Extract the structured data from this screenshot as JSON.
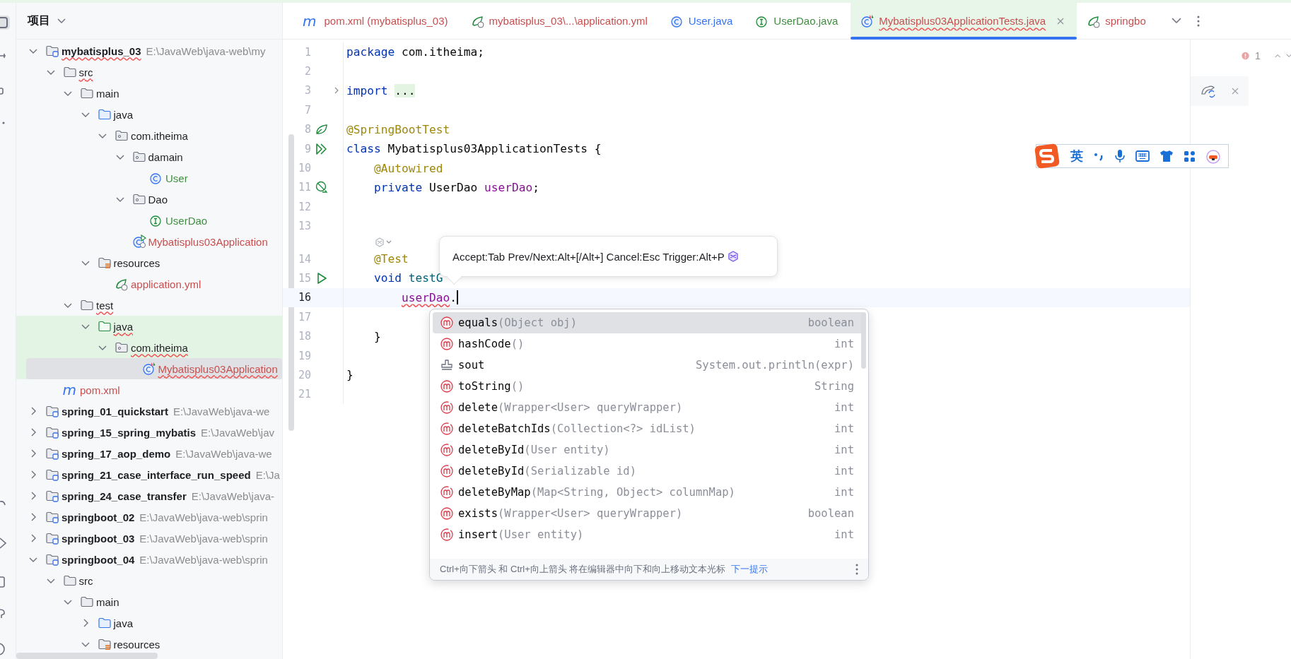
{
  "project_panel": {
    "title": "项目"
  },
  "tree": [
    {
      "label": "mybatisplus_03",
      "path": "E:\\JavaWeb\\java-web\\my",
      "kind": "module",
      "expanded": true,
      "selected": false,
      "highlighted": false,
      "error": true,
      "children": [
        {
          "label": "src",
          "kind": "folder",
          "expanded": true,
          "selected": false,
          "highlighted": false,
          "error": true,
          "children": [
            {
              "label": "main",
              "kind": "folder",
              "expanded": true,
              "selected": false,
              "highlighted": false,
              "error": false,
              "children": [
                {
                  "label": "java",
                  "kind": "source-folder",
                  "expanded": true,
                  "selected": false,
                  "highlighted": false,
                  "error": false,
                  "children": [
                    {
                      "label": "com.itheima",
                      "kind": "package",
                      "expanded": true,
                      "selected": false,
                      "highlighted": false,
                      "error": false,
                      "children": [
                        {
                          "label": "damain",
                          "kind": "package",
                          "expanded": true,
                          "selected": false,
                          "highlighted": false,
                          "error": false,
                          "children": [
                            {
                              "label": "User",
                              "kind": "class",
                              "color": "#3f8f3f",
                              "selected": false,
                              "highlighted": false,
                              "error": false
                            }
                          ]
                        },
                        {
                          "label": "Dao",
                          "kind": "package",
                          "expanded": true,
                          "selected": false,
                          "highlighted": false,
                          "error": false,
                          "children": [
                            {
                              "label": "UserDao",
                              "kind": "interface",
                              "color": "#3f8f3f",
                              "selected": false,
                              "highlighted": false,
                              "error": false
                            }
                          ]
                        },
                        {
                          "label": "Mybatisplus03Application",
                          "kind": "spring-class",
                          "color": "#c94f4f",
                          "selected": false,
                          "highlighted": false,
                          "error": false
                        }
                      ]
                    }
                  ]
                },
                {
                  "label": "resources",
                  "kind": "resources",
                  "expanded": true,
                  "selected": false,
                  "highlighted": false,
                  "error": false,
                  "children": [
                    {
                      "label": "application.yml",
                      "kind": "spring-file",
                      "color": "#c94f4f",
                      "selected": false,
                      "highlighted": false,
                      "error": false
                    }
                  ]
                }
              ]
            },
            {
              "label": "test",
              "kind": "folder",
              "expanded": true,
              "selected": false,
              "highlighted": false,
              "error": true,
              "children": [
                {
                  "label": "java",
                  "kind": "test-folder",
                  "expanded": true,
                  "selected": false,
                  "highlighted": true,
                  "error": true,
                  "children": [
                    {
                      "label": "com.itheima",
                      "kind": "package",
                      "expanded": true,
                      "selected": false,
                      "highlighted": true,
                      "error": true,
                      "children": [
                        {
                          "label": "Mybatisplus03Application",
                          "kind": "test-class",
                          "color": "#c94f4f",
                          "selected": true,
                          "highlighted": true,
                          "error": true
                        }
                      ]
                    }
                  ]
                }
              ]
            }
          ]
        },
        {
          "label": "pom.xml",
          "kind": "pom",
          "glyph": "m",
          "color": "#c94f4f",
          "selected": false,
          "highlighted": false,
          "error": false
        }
      ]
    },
    {
      "label": "spring_01_quickstart",
      "path": "E:\\JavaWeb\\java-we",
      "kind": "module",
      "expanded": false,
      "selected": false,
      "highlighted": false,
      "error": false
    },
    {
      "label": "spring_15_spring_mybatis",
      "path": "E:\\JavaWeb\\jav",
      "kind": "module",
      "expanded": false,
      "selected": false,
      "highlighted": false,
      "error": false
    },
    {
      "label": "spring_17_aop_demo",
      "path": "E:\\JavaWeb\\java-we",
      "kind": "module",
      "expanded": false,
      "selected": false,
      "highlighted": false,
      "error": false
    },
    {
      "label": "spring_21_case_interface_run_speed",
      "path": "E:\\Ja",
      "kind": "module",
      "expanded": false,
      "selected": false,
      "highlighted": false,
      "error": false
    },
    {
      "label": "spring_24_case_transfer",
      "path": "E:\\JavaWeb\\java-",
      "kind": "module",
      "expanded": false,
      "selected": false,
      "highlighted": false,
      "error": false
    },
    {
      "label": "springboot_02",
      "path": "E:\\JavaWeb\\java-web\\sprin",
      "kind": "module",
      "expanded": false,
      "selected": false,
      "highlighted": false,
      "error": false
    },
    {
      "label": "springboot_03",
      "path": "E:\\JavaWeb\\java-web\\sprin",
      "kind": "module",
      "expanded": false,
      "selected": false,
      "highlighted": false,
      "error": false
    },
    {
      "label": "springboot_04",
      "path": "E:\\JavaWeb\\java-web\\sprin",
      "kind": "module",
      "expanded": true,
      "selected": false,
      "highlighted": false,
      "error": false,
      "children": [
        {
          "label": "src",
          "kind": "folder",
          "expanded": true,
          "selected": false,
          "highlighted": false,
          "error": false,
          "children": [
            {
              "label": "main",
              "kind": "folder",
              "expanded": true,
              "selected": false,
              "highlighted": false,
              "error": false,
              "children": [
                {
                  "label": "java",
                  "kind": "source-folder",
                  "expanded": false,
                  "selected": false,
                  "highlighted": false,
                  "error": false
                },
                {
                  "label": "resources",
                  "kind": "resources",
                  "expanded": true,
                  "selected": false,
                  "highlighted": false,
                  "error": false
                }
              ]
            }
          ]
        }
      ]
    }
  ],
  "tabs": [
    {
      "label": "pom.xml (mybatisplus_03)",
      "kind": "pom",
      "glyph": "m",
      "color": "#c94f4f",
      "selected": false,
      "error": false
    },
    {
      "label": "mybatisplus_03\\...\\application.yml",
      "kind": "spring-file",
      "color": "#c94f4f",
      "selected": false,
      "error": false
    },
    {
      "label": "User.java",
      "kind": "class",
      "color": "#3574f0",
      "selected": false,
      "error": false
    },
    {
      "label": "UserDao.java",
      "kind": "interface",
      "color": "#3f8f3f",
      "selected": false,
      "error": false
    },
    {
      "label": "Mybatisplus03ApplicationTests.java",
      "kind": "test-class",
      "color": "#c94f4f",
      "selected": true,
      "error": true
    },
    {
      "label": "springbo",
      "kind": "spring-file",
      "color": "#c94f4f",
      "selected": false,
      "error": false
    }
  ],
  "problems": {
    "count": "1"
  },
  "lines": [
    {
      "number": "1",
      "kind": "plain",
      "tokens": [
        {
          "kind": "keyword",
          "text": "package"
        },
        {
          "kind": "plain",
          "text": " com.itheima;"
        }
      ]
    },
    {
      "number": "2",
      "kind": "plain"
    },
    {
      "number": "3",
      "kind": "plain",
      "fold": true,
      "tokens": [
        {
          "kind": "keyword",
          "text": "import "
        },
        {
          "kind": "folded",
          "text": "..."
        }
      ]
    },
    {
      "number": "7",
      "kind": "plain"
    },
    {
      "number": "8",
      "kind": "spring",
      "tokens": [
        {
          "kind": "annotation",
          "text": "@SpringBootTest"
        }
      ]
    },
    {
      "number": "9",
      "kind": "run-all",
      "tokens": [
        {
          "kind": "keyword",
          "text": "class"
        },
        {
          "kind": "plain",
          "text": " Mybatisplus03ApplicationTests {"
        }
      ]
    },
    {
      "number": "10",
      "kind": "plain",
      "tokens": [
        {
          "kind": "annotation",
          "text": "    @Autowired"
        }
      ]
    },
    {
      "number": "11",
      "kind": "bean",
      "tokens": [
        {
          "kind": "keyword",
          "text": "    private"
        },
        {
          "kind": "plain",
          "text": " UserDao "
        },
        {
          "kind": "field",
          "text": "userDao"
        },
        {
          "kind": "plain",
          "text": ";"
        }
      ]
    },
    {
      "number": "12",
      "kind": "plain"
    },
    {
      "number": "13",
      "kind": "plain"
    },
    {
      "kind": "hint"
    },
    {
      "number": "14",
      "kind": "plain",
      "tokens": [
        {
          "kind": "annotation",
          "text": "    @Test"
        }
      ]
    },
    {
      "number": "15",
      "kind": "run",
      "tokens": [
        {
          "kind": "keyword",
          "text": "    void"
        },
        {
          "kind": "method",
          "text": " testG"
        }
      ]
    },
    {
      "number": "16",
      "kind": "plain",
      "current": true,
      "caret": true,
      "tokens": [
        {
          "kind": "field-error",
          "text": "        userDao"
        },
        {
          "kind": "plain",
          "text": "."
        }
      ]
    },
    {
      "number": "17",
      "kind": "plain"
    },
    {
      "number": "18",
      "kind": "plain",
      "tokens": [
        {
          "kind": "plain",
          "text": "    }"
        }
      ]
    },
    {
      "number": "19",
      "kind": "plain"
    },
    {
      "number": "20",
      "kind": "plain",
      "tokens": [
        {
          "kind": "plain",
          "text": "}"
        }
      ]
    },
    {
      "number": "21",
      "kind": "plain"
    }
  ],
  "ai_tooltip": {
    "text": "Accept:Tab Prev/Next:Alt+[/Alt+] Cancel:Esc Trigger:Alt+P"
  },
  "completion": {
    "items": [
      {
        "kind": "method",
        "name": "equals",
        "params": "(Object obj)",
        "type": "boolean",
        "selected": true
      },
      {
        "kind": "method",
        "name": "hashCode",
        "params": "()",
        "type": "int",
        "selected": false
      },
      {
        "kind": "template",
        "name": "sout",
        "type": "System.out.println(expr)",
        "selected": false
      },
      {
        "kind": "method",
        "name": "toString",
        "params": "()",
        "type": "String",
        "selected": false
      },
      {
        "kind": "inherited-method",
        "name": "delete",
        "params": "(Wrapper<User> queryWrapper)",
        "type": "int",
        "selected": false
      },
      {
        "kind": "inherited-method",
        "name": "deleteBatchIds",
        "params": "(Collection<?> idList)",
        "type": "int",
        "selected": false
      },
      {
        "kind": "inherited-method",
        "name": "deleteById",
        "params": "(User entity)",
        "type": "int",
        "selected": false
      },
      {
        "kind": "inherited-method",
        "name": "deleteById",
        "params": "(Serializable id)",
        "type": "int",
        "selected": false
      },
      {
        "kind": "inherited-method",
        "name": "deleteByMap",
        "params": "(Map<String, Object> columnMap)",
        "type": "int",
        "selected": false
      },
      {
        "kind": "method",
        "name": "exists",
        "params": "(Wrapper<User> queryWrapper)",
        "type": "boolean",
        "selected": false
      },
      {
        "kind": "inherited-method",
        "name": "insert",
        "params": "(User entity)",
        "type": "int",
        "selected": false
      }
    ],
    "footer": "Ctrl+向下箭头 和 Ctrl+向上箭头 将在编辑器中向下和向上移动文本光标",
    "footer_link": "下一提示"
  },
  "ime_bar": {
    "mode": "英"
  }
}
